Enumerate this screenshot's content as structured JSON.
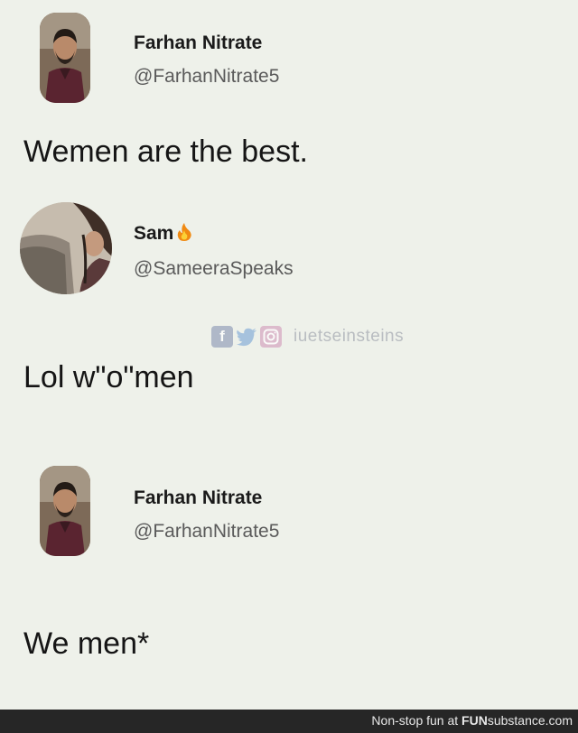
{
  "tweets": [
    {
      "display_name": "Farhan Nitrate",
      "handle": "@FarhanNitrate5",
      "text": "Wemen are the best.",
      "avatar": "man-portrait-avatar"
    },
    {
      "display_name": "Sam",
      "name_emoji": "fire-icon",
      "handle": "@SameeraSpeaks",
      "text": "Lol w\"o\"men",
      "avatar": "woman-in-car-avatar"
    },
    {
      "display_name": "Farhan Nitrate",
      "handle": "@FarhanNitrate5",
      "text": "We men*",
      "avatar": "man-portrait-avatar"
    }
  ],
  "watermark": {
    "icons": [
      "facebook-icon",
      "twitter-icon",
      "instagram-icon"
    ],
    "facebook_glyph": "f",
    "text": "iuetseinsteins"
  },
  "footer": {
    "prefix": "Non-stop fun at ",
    "brand_bold": "FUN",
    "brand_rest": "substance.com"
  },
  "colors": {
    "background": "#eef1ea",
    "footer": "#262626",
    "handle": "#5a5a5a"
  }
}
